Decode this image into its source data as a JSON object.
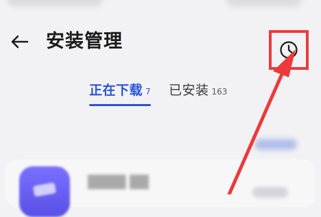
{
  "header": {
    "title": "安装管理",
    "back_icon": "arrow-left-icon",
    "history_icon": "clock-icon"
  },
  "tabs": [
    {
      "label": "正在下载",
      "count": "7",
      "active": true
    },
    {
      "label": "已安装",
      "count": "163",
      "active": false
    }
  ],
  "colors": {
    "accent": "#2a54d6",
    "annotation": "#ec3a3a",
    "background": "#f2f2f4"
  },
  "annotations": {
    "arrow_icon": "red-arrow",
    "highlight_box": "red-rectangle"
  }
}
